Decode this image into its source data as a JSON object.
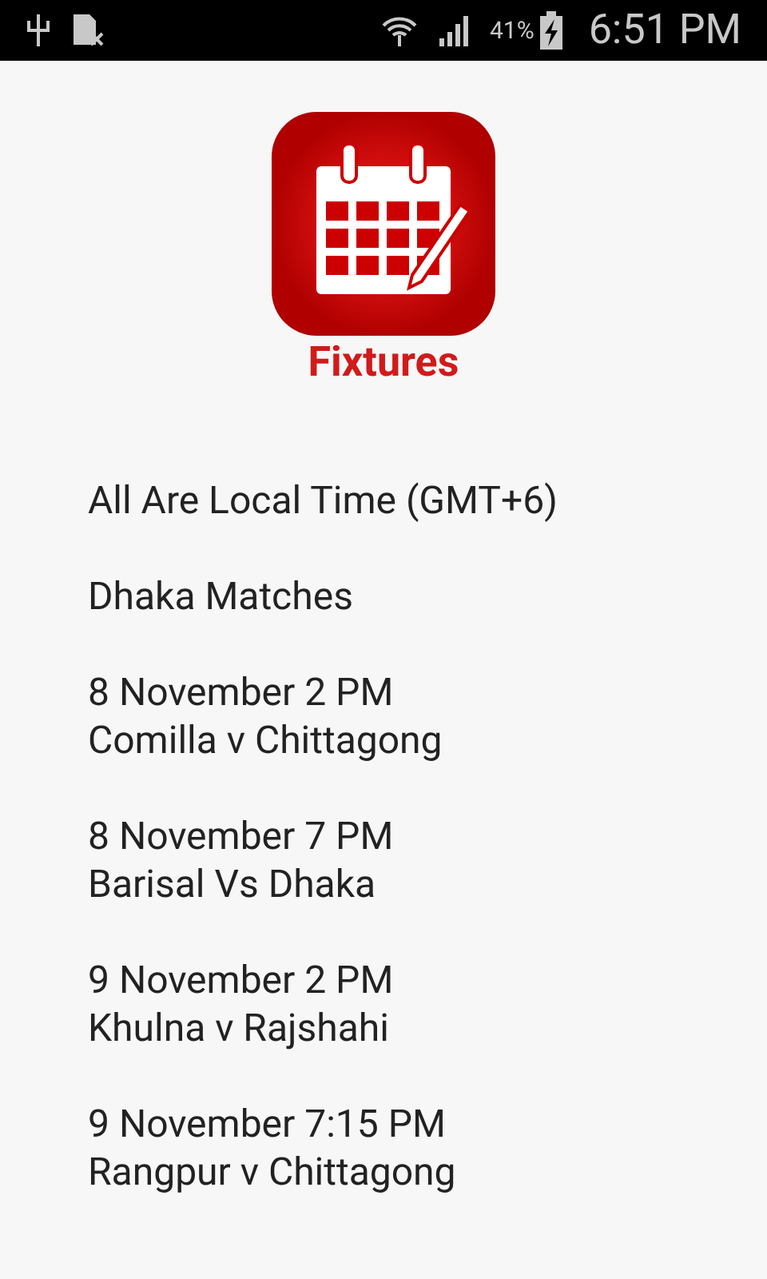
{
  "status_bar": {
    "battery": "41%",
    "time": "6:51 PM"
  },
  "logo": {
    "title": "Fixtures"
  },
  "note": "All Are Local Time (GMT+6)",
  "section": "Dhaka Matches",
  "fixtures": [
    {
      "date": "8 November 2 PM",
      "teams": "Comilla v Chittagong"
    },
    {
      "date": "8 November 7 PM",
      "teams": "Barisal Vs Dhaka"
    },
    {
      "date": "9 November 2 PM",
      "teams": "Khulna v Rajshahi"
    },
    {
      "date": "9 November 7:15 PM",
      "teams": "Rangpur v Chittagong"
    }
  ]
}
